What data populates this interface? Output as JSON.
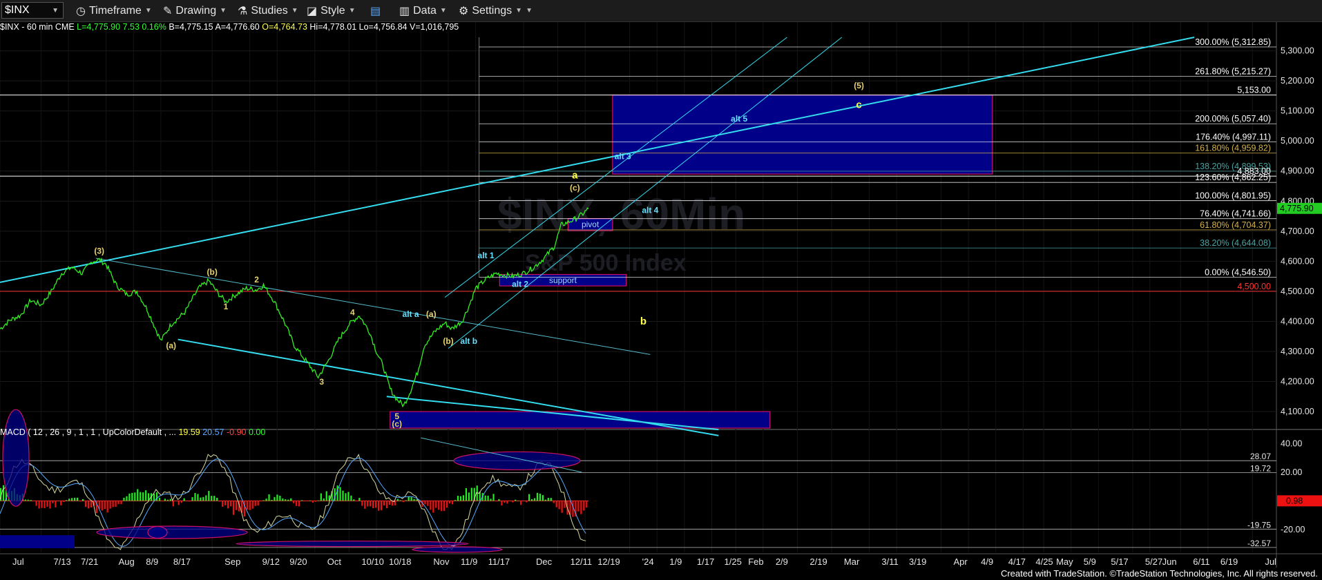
{
  "toolbar": {
    "symbol": "$INX",
    "items": [
      {
        "label": "Timeframe"
      },
      {
        "label": "Drawing"
      },
      {
        "label": "Studies"
      },
      {
        "label": "Style"
      },
      {
        "label": ""
      },
      {
        "label": "Data"
      },
      {
        "label": "Settings"
      }
    ]
  },
  "header": {
    "symbol": "$INX - 60 min",
    "exchange": "CME",
    "last": "L=4,775.90",
    "change": "7.53",
    "pct": "0.16%",
    "bid": "B=4,775.15",
    "ask": "A=4,776.60",
    "open": "O=4,764.73",
    "high": "Hi=4,778.01",
    "low": "Lo=4,756.84",
    "volume": "V=1,016,795"
  },
  "macd_header": {
    "label": "MACD ( 12 , 26 , 9 , 1 , 1 , UpColorDefault , ...",
    "v1": "19.59",
    "v2": "20.57",
    "v3": "-0.90",
    "v4": "0.00"
  },
  "watermark": {
    "title": "$INX, 60Min",
    "subtitle": "S&P 500 Index"
  },
  "footer": "Created with TradeStation. ©TradeStation Technologies, Inc. All rights reserved.",
  "chart_data": {
    "type": "line",
    "price_axis": {
      "ticks": [
        "5,300.00",
        "5,200.00",
        "5,100.00",
        "5,000.00",
        "4,900.00",
        "4,800.00",
        "4,700.00",
        "4,600.00",
        "4,500.00",
        "4,400.00",
        "4,300.00",
        "4,200.00",
        "4,100.00"
      ],
      "tick_values": [
        5300,
        5200,
        5100,
        5000,
        4900,
        4800,
        4700,
        4600,
        4500,
        4400,
        4300,
        4200,
        4100
      ],
      "last_price": "4,775.90",
      "ylim": [
        4045,
        5345
      ]
    },
    "macd_axis": {
      "ticks": [
        "40.00",
        "20.00",
        "-20.00"
      ],
      "tick_values": [
        40,
        20,
        -20
      ],
      "ylim": [
        -36,
        46
      ],
      "level_labels": [
        "28.07",
        "19.72",
        "-19.75",
        "-32.57"
      ],
      "level_values": [
        28.07,
        19.72,
        -19.75,
        -32.57
      ],
      "current": "0.98"
    },
    "x_axis": {
      "labels": [
        "Jul",
        "7/13",
        "7/21",
        "Aug",
        "8/9",
        "8/17",
        "Sep",
        "9/12",
        "9/20",
        "Oct",
        "10/10",
        "10/18",
        "Nov",
        "11/9",
        "11/17",
        "Dec",
        "12/11",
        "12/19",
        "'24",
        "1/9",
        "1/17",
        "1/25",
        "Feb",
        "2/9",
        "2/19",
        "Mar",
        "3/11",
        "3/19",
        "Apr",
        "4/9",
        "4/17",
        "4/25",
        "May",
        "5/9",
        "5/17",
        "5/27",
        "Jun",
        "6/11",
        "6/19",
        "Jul"
      ],
      "day_index": [
        0,
        12,
        20,
        31,
        39,
        47,
        62,
        73,
        81,
        92,
        102,
        110,
        123,
        131,
        139,
        153,
        163,
        171,
        184,
        192,
        200,
        208,
        215,
        223,
        233,
        243,
        254,
        262,
        275,
        283,
        291,
        299,
        305,
        313,
        321,
        331,
        336,
        345,
        353,
        366
      ]
    },
    "price_series": {
      "name": "",
      "points": [
        [
          0,
          4375
        ],
        [
          3,
          4405
        ],
        [
          6,
          4420
        ],
        [
          9,
          4470
        ],
        [
          12,
          4455
        ],
        [
          15,
          4500
        ],
        [
          18,
          4560
        ],
        [
          21,
          4580
        ],
        [
          24,
          4560
        ],
        [
          27,
          4600
        ],
        [
          29,
          4605
        ],
        [
          31,
          4590
        ],
        [
          34,
          4520
        ],
        [
          37,
          4490
        ],
        [
          40,
          4500
        ],
        [
          43,
          4440
        ],
        [
          47,
          4335
        ],
        [
          50,
          4390
        ],
        [
          54,
          4430
        ],
        [
          58,
          4510
        ],
        [
          61,
          4535
        ],
        [
          64,
          4490
        ],
        [
          66,
          4465
        ],
        [
          69,
          4490
        ],
        [
          72,
          4510
        ],
        [
          75,
          4505
        ],
        [
          77,
          4520
        ],
        [
          80,
          4470
        ],
        [
          83,
          4400
        ],
        [
          86,
          4320
        ],
        [
          88,
          4290
        ],
        [
          90,
          4260
        ],
        [
          93,
          4215
        ],
        [
          96,
          4270
        ],
        [
          99,
          4340
        ],
        [
          102,
          4390
        ],
        [
          105,
          4420
        ],
        [
          108,
          4365
        ],
        [
          110,
          4300
        ],
        [
          112,
          4250
        ],
        [
          114,
          4175
        ],
        [
          116,
          4140
        ],
        [
          118,
          4120
        ],
        [
          120,
          4170
        ],
        [
          122,
          4230
        ],
        [
          124,
          4320
        ],
        [
          127,
          4365
        ],
        [
          130,
          4395
        ],
        [
          132,
          4375
        ],
        [
          135,
          4400
        ],
        [
          137,
          4450
        ],
        [
          139,
          4510
        ],
        [
          142,
          4540
        ],
        [
          145,
          4560
        ],
        [
          147,
          4555
        ],
        [
          150,
          4550
        ],
        [
          153,
          4560
        ],
        [
          156,
          4580
        ],
        [
          159,
          4610
        ],
        [
          162,
          4650
        ],
        [
          164,
          4720
        ],
        [
          166,
          4730
        ],
        [
          168,
          4740
        ],
        [
          170,
          4755
        ],
        [
          172,
          4775
        ]
      ]
    },
    "fib_levels": [
      {
        "label": "300.00% (5,312.85)",
        "value": 5312.85,
        "color": "#ffffff"
      },
      {
        "label": "261.80% (5,215.27)",
        "value": 5215.27,
        "color": "#ffffff"
      },
      {
        "label": "200.00% (5,057.40)",
        "value": 5057.4,
        "color": "#ffffff"
      },
      {
        "label": "176.40% (4,997.11)",
        "value": 4997.11,
        "color": "#ffffff"
      },
      {
        "label": "161.80% (4,959.82)",
        "value": 4959.82,
        "color": "#d4b24a"
      },
      {
        "label": "138.20% (4,899.53)",
        "value": 4899.53,
        "color": "#4aa3a3"
      },
      {
        "label": "123.60% (4,862.25)",
        "value": 4862.25,
        "color": "#ffffff"
      },
      {
        "label": "100.00% (4,801.95)",
        "value": 4801.95,
        "color": "#ffffff"
      },
      {
        "label": "76.40% (4,741.66)",
        "value": 4741.66,
        "color": "#ffffff"
      },
      {
        "label": "61.80% (4,704.37)",
        "value": 4704.37,
        "color": "#d4b24a"
      },
      {
        "label": "38.20% (4,644.08)",
        "value": 4644.08,
        "color": "#4aa3a3"
      },
      {
        "label": "0.00% (4,546.50)",
        "value": 4546.5,
        "color": "#ffffff"
      }
    ],
    "horizontal_lines": [
      {
        "label": "5,153.00",
        "value": 5153,
        "color": "#ffffff"
      },
      {
        "label": "4,883.00",
        "value": 4883,
        "color": "#ffffff"
      },
      {
        "label": "4,500.00",
        "value": 4500,
        "color": "#ff3333"
      }
    ],
    "annotations": [
      {
        "text": "(3)",
        "day": 29,
        "value": 4625,
        "color": "#e8d36a"
      },
      {
        "text": "(b)",
        "day": 62,
        "value": 4555,
        "color": "#e8d36a"
      },
      {
        "text": "2",
        "day": 75,
        "value": 4530,
        "color": "#e8d36a"
      },
      {
        "text": "1",
        "day": 66,
        "value": 4440,
        "color": "#e8d36a"
      },
      {
        "text": "4",
        "day": 103,
        "value": 4420,
        "color": "#e8d36a"
      },
      {
        "text": "(a)",
        "day": 50,
        "value": 4310,
        "color": "#e8d36a"
      },
      {
        "text": "3",
        "day": 94,
        "value": 4190,
        "color": "#e8d36a"
      },
      {
        "text": "5",
        "day": 116,
        "value": 4075,
        "color": "#e8d36a"
      },
      {
        "text": "(c)",
        "day": 116,
        "value": 4050,
        "color": "#e8d36a"
      },
      {
        "text": "alt a",
        "day": 120,
        "value": 4415,
        "color": "#66e0ff"
      },
      {
        "text": "(a)",
        "day": 126,
        "value": 4415,
        "color": "#e8d36a"
      },
      {
        "text": "(b)",
        "day": 131,
        "value": 4325,
        "color": "#e8d36a"
      },
      {
        "text": "alt b",
        "day": 137,
        "value": 4325,
        "color": "#66e0ff"
      },
      {
        "text": "alt 1",
        "day": 142,
        "value": 4610,
        "color": "#66e0ff"
      },
      {
        "text": "alt 2",
        "day": 152,
        "value": 4515,
        "color": "#66e0ff"
      },
      {
        "text": "a",
        "day": 168,
        "value": 4875,
        "color": "#ffff44"
      },
      {
        "text": "(c)",
        "day": 168,
        "value": 4835,
        "color": "#e8d36a"
      },
      {
        "text": "alt 4",
        "day": 190,
        "value": 4760,
        "color": "#66e0ff"
      },
      {
        "text": "alt 3",
        "day": 182,
        "value": 4940,
        "color": "#66e0ff"
      },
      {
        "text": "alt 5",
        "day": 216,
        "value": 5065,
        "color": "#66e0ff"
      },
      {
        "text": "(5)",
        "day": 251,
        "value": 5175,
        "color": "#e8d36a"
      },
      {
        "text": "c",
        "day": 251,
        "value": 5110,
        "color": "#ffff44"
      },
      {
        "text": "b",
        "day": 188,
        "value": 4390,
        "color": "#ffff44"
      }
    ],
    "boxes": [
      {
        "label": "pivot",
        "day0": 166,
        "day1": 179,
        "v0": 4702,
        "v1": 4742
      },
      {
        "label": "support",
        "day0": 146,
        "day1": 183,
        "v0": 4518,
        "v1": 4556
      },
      {
        "label": "",
        "day0": 179,
        "day1": 290,
        "v0": 4890,
        "v1": 5153
      },
      {
        "label": "",
        "day0": 114,
        "day1": 225,
        "v0": 4020,
        "v1": 4100
      }
    ],
    "trend_lines": [
      {
        "p": [
          [
            0,
            4530
          ],
          [
            349,
            5345
          ]
        ],
        "color": "#33ddee",
        "w": 2
      },
      {
        "p": [
          [
            52,
            4340
          ],
          [
            210,
            4020
          ]
        ],
        "color": "#33ddee",
        "w": 2
      },
      {
        "p": [
          [
            28,
            4610
          ],
          [
            190,
            4290
          ]
        ],
        "color": "#55bbcc",
        "w": 1
      },
      {
        "p": [
          [
            113,
            4150
          ],
          [
            210,
            4040
          ]
        ],
        "color": "#33ddee",
        "w": 2
      },
      {
        "p": [
          [
            130,
            4480
          ],
          [
            230,
            5345
          ]
        ],
        "color": "#33ddee",
        "w": 1
      },
      {
        "p": [
          [
            131,
            4310
          ],
          [
            246,
            5345
          ]
        ],
        "color": "#33ddee",
        "w": 1
      }
    ]
  }
}
